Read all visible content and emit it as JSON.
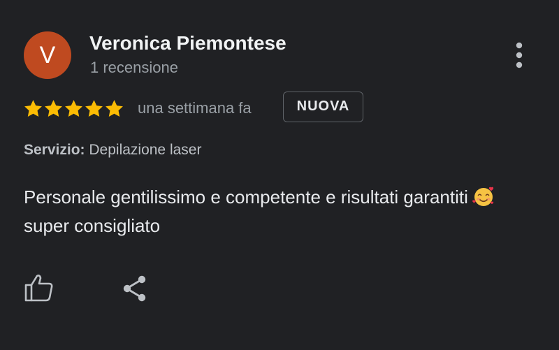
{
  "review": {
    "avatar_initial": "V",
    "avatar_color": "#bf4a20",
    "reviewer_name": "Veronica Piemontese",
    "review_count": "1 recensione",
    "rating": 5,
    "rating_max": 5,
    "star_color": "#fbbc04",
    "relative_time": "una settimana fa",
    "badge": "NUOVA",
    "service_label": "Servizio:",
    "service_value": "Depilazione laser",
    "text_part1": "Personale gentilissimo e competente e risultati garantiti",
    "emoji": "smiling-face-with-hearts",
    "text_part2": "super consigliato"
  },
  "actions": {
    "more_icon": "more-vert-icon",
    "like_icon": "thumb-up-icon",
    "share_icon": "share-icon"
  },
  "theme": {
    "background": "#202124",
    "text_primary": "#e8eaed",
    "text_secondary": "#9aa0a6"
  }
}
